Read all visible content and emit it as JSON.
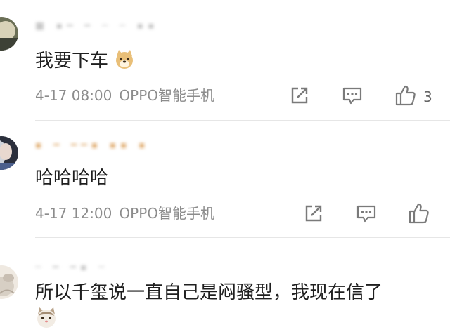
{
  "comments": [
    {
      "text": "我要下车",
      "time": "4-17 08:00",
      "device": "OPPO智能手机",
      "likes": "3",
      "emoji": "doge-emoji"
    },
    {
      "text": "哈哈哈哈",
      "time": "4-17 12:00",
      "device": "OPPO智能手机",
      "likes": ""
    },
    {
      "text": "所以千玺说一直自己是闷骚型，我现在信了",
      "emoji": "cat-emoji"
    }
  ],
  "icons": {
    "share": "share-icon",
    "comment": "comment-icon",
    "like": "thumbs-up-icon"
  },
  "colors": {
    "text": "#1f1f1f",
    "meta": "#8c8c8c",
    "icon": "#7a7a7a",
    "divider": "#e6e6e6"
  }
}
